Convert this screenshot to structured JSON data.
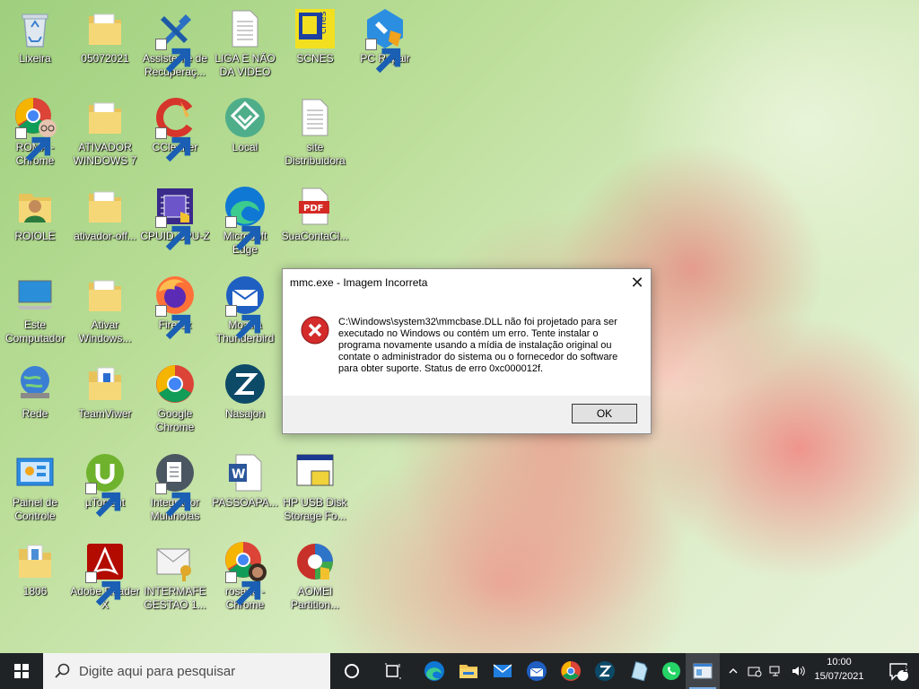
{
  "desktop": {
    "icons": [
      {
        "label": "Lixeira",
        "icon": "recycle-bin-icon"
      },
      {
        "label": "05072021",
        "icon": "folder-icon"
      },
      {
        "label": "Assistente de Recuperaç...",
        "icon": "recovery-tools-icon"
      },
      {
        "label": "LIGA E NÃO DA VIDEO",
        "icon": "text-file-icon"
      },
      {
        "label": "SCNES",
        "icon": "scnes-app-icon"
      },
      {
        "label": "PC Repair",
        "icon": "pc-repair-icon"
      },
      {
        "label": "ROMA - Chrome",
        "icon": "chrome-profile-icon"
      },
      {
        "label": "ATIVADOR WINDOWS 7",
        "icon": "folder-icon"
      },
      {
        "label": "CCleaner",
        "icon": "ccleaner-icon"
      },
      {
        "label": "Local",
        "icon": "local-app-icon"
      },
      {
        "label": "site Distribuidora",
        "icon": "text-file-icon"
      },
      {
        "label": "ROIOLE",
        "icon": "user-folder-icon"
      },
      {
        "label": "ativador-off...",
        "icon": "folder-icon"
      },
      {
        "label": "CPUID CPU-Z",
        "icon": "cpuz-icon"
      },
      {
        "label": "Microsoft Edge",
        "icon": "edge-icon"
      },
      {
        "label": "SuaContaCl...",
        "icon": "pdf-file-icon"
      },
      {
        "label": "Este Computador",
        "icon": "computer-icon"
      },
      {
        "label": "Ativar Windows...",
        "icon": "folder-icon"
      },
      {
        "label": "Firefox",
        "icon": "firefox-icon"
      },
      {
        "label": "Mozilla Thunderbird",
        "icon": "thunderbird-icon"
      },
      {
        "label": "Rede",
        "icon": "network-icon"
      },
      {
        "label": "TeamViwer",
        "icon": "teamviewer-folder-icon"
      },
      {
        "label": "Google Chrome",
        "icon": "chrome-icon"
      },
      {
        "label": "Nasajon",
        "icon": "nasajon-icon"
      },
      {
        "label": "Painel de Controle",
        "icon": "control-panel-icon"
      },
      {
        "label": "µTorrent",
        "icon": "utorrent-icon"
      },
      {
        "label": "Integrador Multinotas",
        "icon": "integrador-icon"
      },
      {
        "label": "PASSOAPA...",
        "icon": "word-doc-icon"
      },
      {
        "label": "HP USB Disk Storage Fo...",
        "icon": "hp-usb-icon"
      },
      {
        "label": "1806",
        "icon": "zip-folder-icon"
      },
      {
        "label": "Adobe Reader X",
        "icon": "adobe-reader-icon"
      },
      {
        "label": "INTERMAFE GESTAO 1...",
        "icon": "intermafe-icon"
      },
      {
        "label": "rosane - Chrome",
        "icon": "chrome-profile-icon"
      },
      {
        "label": "AOMEI Partition...",
        "icon": "aomei-icon"
      }
    ]
  },
  "dialog": {
    "title": "mmc.exe - Imagem Incorreta",
    "message": "C:\\Windows\\system32\\mmcbase.DLL não foi projetado para ser executado no Windows ou contém um erro. Tente instalar o programa novamente usando a mídia de instalação original ou contate o administrador do sistema ou o fornecedor do software para obter suporte. Status de erro 0xc000012f.",
    "ok_label": "OK",
    "close_glyph": "✕",
    "icon": "error-icon"
  },
  "taskbar": {
    "search_placeholder": "Digite aqui para pesquisar",
    "apps": [
      "cortana-icon",
      "task-view-icon",
      "edge-icon",
      "file-explorer-icon",
      "mail-icon",
      "thunderbird-icon",
      "chrome-icon",
      "nasajon-icon",
      "notepad-icon",
      "whatsapp-icon",
      "mmc-icon"
    ],
    "time": "10:00",
    "date": "15/07/2021",
    "notification_count": "2",
    "accent": "#7cb0e6",
    "bg": "#202326"
  }
}
